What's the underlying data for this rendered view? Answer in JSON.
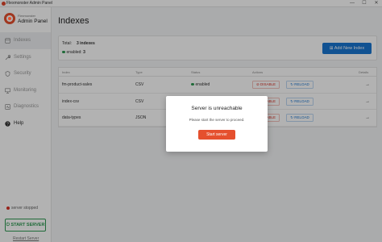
{
  "window": {
    "title": "Flexmonster Admin Panel",
    "controls": [
      "—",
      "☐",
      "✕"
    ]
  },
  "brand": {
    "small": "Flexmonster",
    "big": "Admin Panel"
  },
  "nav": [
    {
      "label": "Indexes",
      "icon": "database-icon"
    },
    {
      "label": "Settings",
      "icon": "wrench-icon"
    },
    {
      "label": "Security",
      "icon": "shield-icon"
    },
    {
      "label": "Monitoring",
      "icon": "monitor-icon"
    },
    {
      "label": "Diagnostics",
      "icon": "diagnostics-icon"
    },
    {
      "label": "Help",
      "icon": "help-icon"
    }
  ],
  "server": {
    "status": "server stopped",
    "start_label": "START SERVER",
    "restart_label": "Restart Server"
  },
  "page": {
    "title": "Indexes",
    "total_label": "Total:",
    "total_value": "3 indexes",
    "enabled_label": "enabled:",
    "enabled_value": "3",
    "add_button": "Add New Index"
  },
  "table": {
    "headers": [
      "Index",
      "Type",
      "Status",
      "Actions",
      "Details"
    ],
    "rows": [
      {
        "name": "fm-product-sales",
        "type": "CSV",
        "status": "enabled",
        "disable": "DISABLE",
        "reload": "RELOAD"
      },
      {
        "name": "index-csv",
        "type": "CSV",
        "status": "enabled",
        "disable": "DISABLE",
        "reload": "RELOAD"
      },
      {
        "name": "data-types",
        "type": "JSON",
        "status": "enabled",
        "disable": "DISABLE",
        "reload": "RELOAD"
      }
    ]
  },
  "modal": {
    "title": "Server is unreachable",
    "text": "Please start the server to proceed.",
    "button": "Start server"
  },
  "colors": {
    "accent": "#e5502e",
    "primary": "#1976d2",
    "success": "#2e9a52",
    "danger": "#d93025"
  }
}
